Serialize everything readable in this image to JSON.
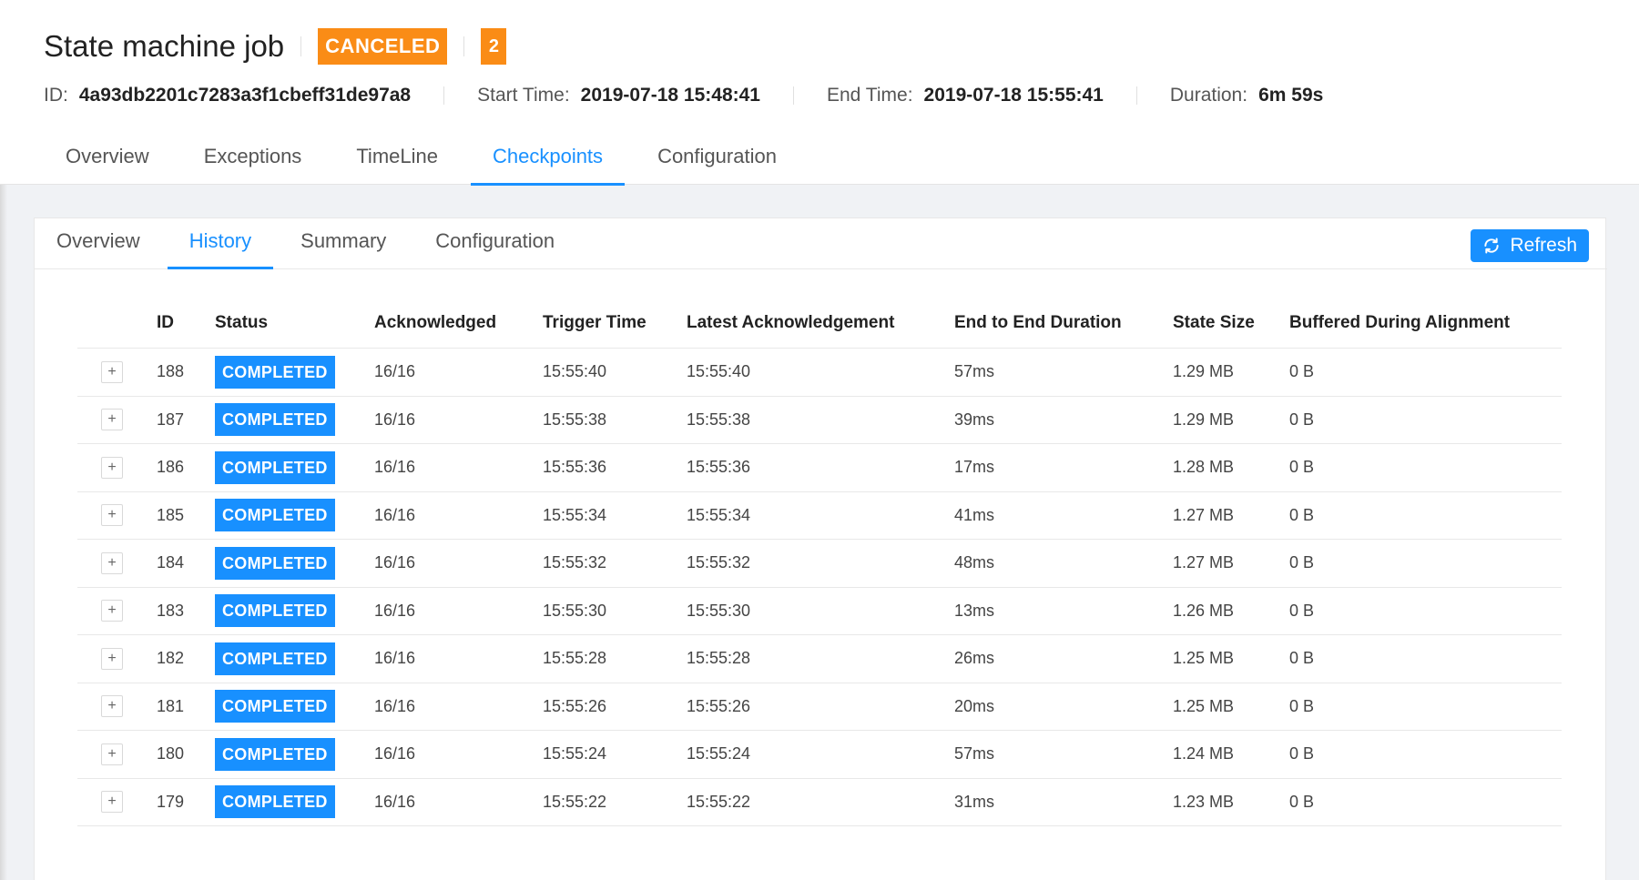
{
  "header": {
    "title": "State machine job",
    "state_badge": "CANCELED",
    "count_badge": "2",
    "id_label": "ID:",
    "id_value": "4a93db2201c7283a3f1cbeff31de97a8",
    "start_label": "Start Time:",
    "start_value": "2019-07-18 15:48:41",
    "end_label": "End Time:",
    "end_value": "2019-07-18 15:55:41",
    "duration_label": "Duration:",
    "duration_value": "6m 59s"
  },
  "main_tabs": [
    "Overview",
    "Exceptions",
    "TimeLine",
    "Checkpoints",
    "Configuration"
  ],
  "main_tab_active": "Checkpoints",
  "sub_tabs": [
    "Overview",
    "History",
    "Summary",
    "Configuration"
  ],
  "sub_tab_active": "History",
  "refresh_label": "Refresh",
  "table": {
    "columns": [
      "ID",
      "Status",
      "Acknowledged",
      "Trigger Time",
      "Latest Acknowledgement",
      "End to End Duration",
      "State Size",
      "Buffered During Alignment"
    ],
    "rows": [
      {
        "id": "188",
        "status": "COMPLETED",
        "ack": "16/16",
        "trigger": "15:55:40",
        "latest": "15:55:40",
        "e2e": "57ms",
        "size": "1.29 MB",
        "buffered": "0 B"
      },
      {
        "id": "187",
        "status": "COMPLETED",
        "ack": "16/16",
        "trigger": "15:55:38",
        "latest": "15:55:38",
        "e2e": "39ms",
        "size": "1.29 MB",
        "buffered": "0 B"
      },
      {
        "id": "186",
        "status": "COMPLETED",
        "ack": "16/16",
        "trigger": "15:55:36",
        "latest": "15:55:36",
        "e2e": "17ms",
        "size": "1.28 MB",
        "buffered": "0 B"
      },
      {
        "id": "185",
        "status": "COMPLETED",
        "ack": "16/16",
        "trigger": "15:55:34",
        "latest": "15:55:34",
        "e2e": "41ms",
        "size": "1.27 MB",
        "buffered": "0 B"
      },
      {
        "id": "184",
        "status": "COMPLETED",
        "ack": "16/16",
        "trigger": "15:55:32",
        "latest": "15:55:32",
        "e2e": "48ms",
        "size": "1.27 MB",
        "buffered": "0 B"
      },
      {
        "id": "183",
        "status": "COMPLETED",
        "ack": "16/16",
        "trigger": "15:55:30",
        "latest": "15:55:30",
        "e2e": "13ms",
        "size": "1.26 MB",
        "buffered": "0 B"
      },
      {
        "id": "182",
        "status": "COMPLETED",
        "ack": "16/16",
        "trigger": "15:55:28",
        "latest": "15:55:28",
        "e2e": "26ms",
        "size": "1.25 MB",
        "buffered": "0 B"
      },
      {
        "id": "181",
        "status": "COMPLETED",
        "ack": "16/16",
        "trigger": "15:55:26",
        "latest": "15:55:26",
        "e2e": "20ms",
        "size": "1.25 MB",
        "buffered": "0 B"
      },
      {
        "id": "180",
        "status": "COMPLETED",
        "ack": "16/16",
        "trigger": "15:55:24",
        "latest": "15:55:24",
        "e2e": "57ms",
        "size": "1.24 MB",
        "buffered": "0 B"
      },
      {
        "id": "179",
        "status": "COMPLETED",
        "ack": "16/16",
        "trigger": "15:55:22",
        "latest": "15:55:22",
        "e2e": "31ms",
        "size": "1.23 MB",
        "buffered": "0 B"
      }
    ],
    "expand_symbol": "+"
  },
  "colors": {
    "accent": "#1890ff",
    "canceled": "#fa8c16"
  },
  "icons": {
    "refresh": "refresh-icon",
    "expand": "plus-icon"
  }
}
